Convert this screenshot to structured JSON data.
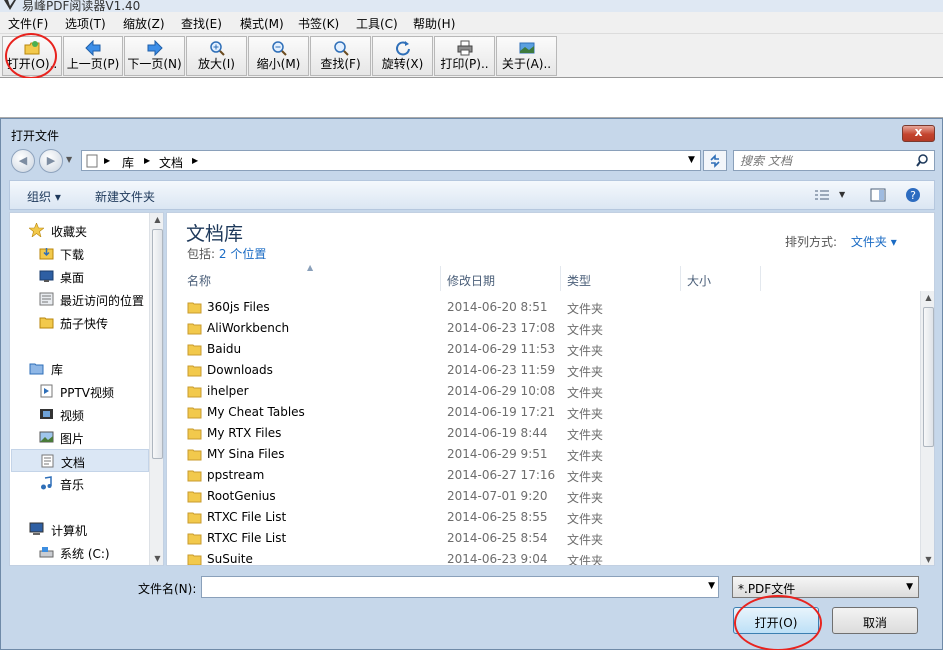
{
  "app": {
    "title": "易峰PDF阅读器V1.40"
  },
  "menu": [
    "文件(F)",
    "选项(T)",
    "缩放(Z)",
    "查找(E)",
    "模式(M)",
    "书签(K)",
    "工具(C)",
    "帮助(H)"
  ],
  "toolbar": {
    "buttons": [
      {
        "label": "打开(O)..",
        "icon": "open-folder-icon"
      },
      {
        "label": "上一页(P)",
        "icon": "arrow-left-icon"
      },
      {
        "label": "下一页(N)",
        "icon": "arrow-right-icon"
      },
      {
        "label": "放大(I)",
        "icon": "zoom-in-icon"
      },
      {
        "label": "缩小(M)",
        "icon": "zoom-out-icon"
      },
      {
        "label": "查找(F)",
        "icon": "magnifier-icon"
      },
      {
        "label": "旋转(X)",
        "icon": "rotate-icon"
      },
      {
        "label": "打印(P)..",
        "icon": "printer-icon"
      },
      {
        "label": "关于(A)..",
        "icon": "about-icon"
      }
    ]
  },
  "dialog": {
    "title": "打开文件",
    "close": "x",
    "breadcrumb": [
      "库",
      "文档"
    ],
    "search_placeholder": "搜索 文档",
    "commands": {
      "organize": "组织 ▾",
      "new_folder": "新建文件夹"
    },
    "nav": {
      "favorites": "收藏夹",
      "favorites_items": [
        "下载",
        "桌面",
        "最近访问的位置",
        "茄子快传"
      ],
      "libraries": "库",
      "libraries_items": [
        "PPTV视频",
        "视频",
        "图片",
        "文档",
        "音乐"
      ],
      "computer": "计算机",
      "computer_items": [
        "系统 (C:)"
      ]
    },
    "library": {
      "title": "文档库",
      "includes_label": "包括:",
      "includes_link": "2 个位置",
      "arrange_label": "排列方式:",
      "arrange_value": "文件夹 ▾"
    },
    "columns": [
      "名称",
      "修改日期",
      "类型",
      "大小"
    ],
    "files": [
      {
        "name": "360js Files",
        "date": "2014-06-20 8:51",
        "type": "文件夹"
      },
      {
        "name": "AliWorkbench",
        "date": "2014-06-23 17:08",
        "type": "文件夹"
      },
      {
        "name": "Baidu",
        "date": "2014-06-29 11:53",
        "type": "文件夹"
      },
      {
        "name": "Downloads",
        "date": "2014-06-23 11:59",
        "type": "文件夹"
      },
      {
        "name": "ihelper",
        "date": "2014-06-29 10:08",
        "type": "文件夹"
      },
      {
        "name": "My Cheat Tables",
        "date": "2014-06-19 17:21",
        "type": "文件夹"
      },
      {
        "name": "My RTX Files",
        "date": "2014-06-19 8:44",
        "type": "文件夹"
      },
      {
        "name": "MY Sina Files",
        "date": "2014-06-29 9:51",
        "type": "文件夹"
      },
      {
        "name": "ppstream",
        "date": "2014-06-27 17:16",
        "type": "文件夹"
      },
      {
        "name": "RootGenius",
        "date": "2014-07-01 9:20",
        "type": "文件夹"
      },
      {
        "name": "RTXC File List",
        "date": "2014-06-25 8:55",
        "type": "文件夹"
      },
      {
        "name": "RTXC File List",
        "date": "2014-06-25 8:54",
        "type": "文件夹"
      },
      {
        "name": "SuSuite",
        "date": "2014-06-23 9:04",
        "type": "文件夹"
      }
    ],
    "filename_label": "文件名(N):",
    "filename_value": "",
    "filter": "*.PDF文件",
    "open_button": "打开(O)",
    "cancel_button": "取消"
  },
  "colors": {
    "highlight_circle": "#e8231e",
    "dialog_frame": "#c6d7ea",
    "link": "#1a6bc4"
  }
}
